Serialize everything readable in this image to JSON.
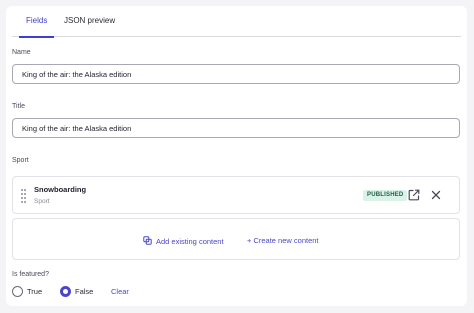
{
  "tabs": [
    {
      "label": "Fields"
    },
    {
      "label": "JSON preview"
    }
  ],
  "fields": {
    "name": {
      "label": "Name",
      "value": "King of the air: the Alaska edition"
    },
    "title": {
      "label": "Title",
      "value": "King of the air: the Alaska edition"
    },
    "sport": {
      "label": "Sport",
      "item": {
        "title": "Snowboarding",
        "type": "Sport",
        "status": "PUBLISHED"
      },
      "add_existing_label": "Add existing content",
      "create_new_label": "+ Create new content"
    },
    "is_featured": {
      "label": "Is featured?",
      "options": [
        {
          "label": "True",
          "checked": false
        },
        {
          "label": "False",
          "checked": true
        }
      ],
      "clear_label": "Clear"
    }
  },
  "colors": {
    "accent": "#4b46c9",
    "published_bg": "#daf2e8",
    "published_text": "#1f5e4a"
  },
  "icons": [
    "drag-handle-icon",
    "open-external-icon",
    "close-icon",
    "link-icon"
  ]
}
